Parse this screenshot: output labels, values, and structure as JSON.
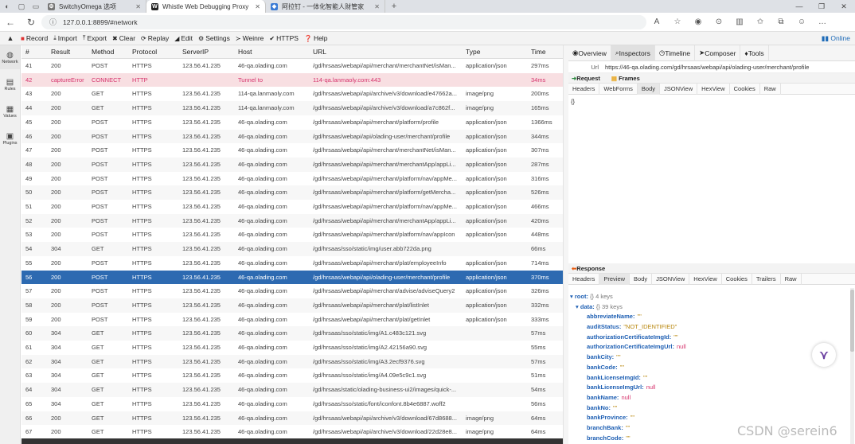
{
  "browser": {
    "tabs": [
      {
        "title": "SwitchyOmega 选项",
        "favicon": "gear-icon"
      },
      {
        "title": "Whistle Web Debugging Proxy",
        "favicon": "w-icon"
      },
      {
        "title": "阿拉钉 - 一体化智能人财管家",
        "favicon": "app-icon"
      }
    ],
    "url": "127.0.0.1:8899/#network"
  },
  "toolbar": {
    "record": "Record",
    "import": "Import",
    "export": "Export",
    "clear": "Clear",
    "replay": "Replay",
    "edit": "Edit",
    "settings": "Settings",
    "weinre": "Weinre",
    "https": "HTTPS",
    "help": "Help",
    "online": "Online"
  },
  "sidebar": [
    {
      "label": "Network"
    },
    {
      "label": "Rules"
    },
    {
      "label": "Values"
    },
    {
      "label": "Plugins"
    }
  ],
  "columns": [
    "#",
    "Result",
    "Method",
    "Protocol",
    "ServerIP",
    "Host",
    "URL",
    "Type",
    "Time"
  ],
  "rows": [
    [
      "41",
      "200",
      "POST",
      "HTTPS",
      "123.56.41.235",
      "46-qa.olading.com",
      "/gd/hrsaas/webapi/api/merchant/merchantNet/isMan...",
      "application/json",
      "297ms"
    ],
    [
      "42",
      "captureError",
      "CONNECT",
      "HTTP",
      "",
      "Tunnel to",
      "114-qa.lanmaoly.com:443",
      "",
      "34ms"
    ],
    [
      "43",
      "200",
      "GET",
      "HTTPS",
      "123.56.41.235",
      "114-qa.lanmaoly.com",
      "/gd/hrsaas/webapi/api/archive/v3/download/e47662a...",
      "image/png",
      "200ms"
    ],
    [
      "44",
      "200",
      "GET",
      "HTTPS",
      "123.56.41.235",
      "114-qa.lanmaoly.com",
      "/gd/hrsaas/webapi/api/archive/v3/download/a7c862f...",
      "image/png",
      "165ms"
    ],
    [
      "45",
      "200",
      "POST",
      "HTTPS",
      "123.56.41.235",
      "46-qa.olading.com",
      "/gd/hrsaas/webapi/api/merchant/platform/profile",
      "application/json",
      "1366ms"
    ],
    [
      "46",
      "200",
      "POST",
      "HTTPS",
      "123.56.41.235",
      "46-qa.olading.com",
      "/gd/hrsaas/webapi/api/olading-user/merchant/profile",
      "application/json",
      "344ms"
    ],
    [
      "47",
      "200",
      "POST",
      "HTTPS",
      "123.56.41.235",
      "46-qa.olading.com",
      "/gd/hrsaas/webapi/api/merchant/merchantNet/isMan...",
      "application/json",
      "307ms"
    ],
    [
      "48",
      "200",
      "POST",
      "HTTPS",
      "123.56.41.235",
      "46-qa.olading.com",
      "/gd/hrsaas/webapi/api/merchant/merchantApp/appLi...",
      "application/json",
      "287ms"
    ],
    [
      "49",
      "200",
      "POST",
      "HTTPS",
      "123.56.41.235",
      "46-qa.olading.com",
      "/gd/hrsaas/webapi/api/merchant/platform/nav/appMe...",
      "application/json",
      "316ms"
    ],
    [
      "50",
      "200",
      "POST",
      "HTTPS",
      "123.56.41.235",
      "46-qa.olading.com",
      "/gd/hrsaas/webapi/api/merchant/platform/getMercha...",
      "application/json",
      "526ms"
    ],
    [
      "51",
      "200",
      "POST",
      "HTTPS",
      "123.56.41.235",
      "46-qa.olading.com",
      "/gd/hrsaas/webapi/api/merchant/platform/nav/appMe...",
      "application/json",
      "466ms"
    ],
    [
      "52",
      "200",
      "POST",
      "HTTPS",
      "123.56.41.235",
      "46-qa.olading.com",
      "/gd/hrsaas/webapi/api/merchant/merchantApp/appLi...",
      "application/json",
      "420ms"
    ],
    [
      "53",
      "200",
      "POST",
      "HTTPS",
      "123.56.41.235",
      "46-qa.olading.com",
      "/gd/hrsaas/webapi/api/merchant/platform/nav/appIcon",
      "application/json",
      "448ms"
    ],
    [
      "54",
      "304",
      "GET",
      "HTTPS",
      "123.56.41.235",
      "46-qa.olading.com",
      "/gd/hrsaas/sso/static/img/user.abb722da.png",
      "",
      "66ms"
    ],
    [
      "55",
      "200",
      "POST",
      "HTTPS",
      "123.56.41.235",
      "46-qa.olading.com",
      "/gd/hrsaas/webapi/api/merchant/plat/employeeInfo",
      "application/json",
      "714ms"
    ],
    [
      "56",
      "200",
      "POST",
      "HTTPS",
      "123.56.41.235",
      "46-qa.olading.com",
      "/gd/hrsaas/webapi/api/olading-user/merchant/profile",
      "application/json",
      "370ms"
    ],
    [
      "57",
      "200",
      "POST",
      "HTTPS",
      "123.56.41.235",
      "46-qa.olading.com",
      "/gd/hrsaas/webapi/api/merchant/advise/adviseQuery2",
      "application/json",
      "326ms"
    ],
    [
      "58",
      "200",
      "POST",
      "HTTPS",
      "123.56.41.235",
      "46-qa.olading.com",
      "/gd/hrsaas/webapi/api/merchant/plat/listInlet",
      "application/json",
      "332ms"
    ],
    [
      "59",
      "200",
      "POST",
      "HTTPS",
      "123.56.41.235",
      "46-qa.olading.com",
      "/gd/hrsaas/webapi/api/merchant/plat/getInlet",
      "application/json",
      "333ms"
    ],
    [
      "60",
      "304",
      "GET",
      "HTTPS",
      "123.56.41.235",
      "46-qa.olading.com",
      "/gd/hrsaas/sso/static/img/A1.c483c121.svg",
      "",
      "57ms"
    ],
    [
      "61",
      "304",
      "GET",
      "HTTPS",
      "123.56.41.235",
      "46-qa.olading.com",
      "/gd/hrsaas/sso/static/img/A2.42156a90.svg",
      "",
      "55ms"
    ],
    [
      "62",
      "304",
      "GET",
      "HTTPS",
      "123.56.41.235",
      "46-qa.olading.com",
      "/gd/hrsaas/sso/static/img/A3.2ecf9376.svg",
      "",
      "57ms"
    ],
    [
      "63",
      "304",
      "GET",
      "HTTPS",
      "123.56.41.235",
      "46-qa.olading.com",
      "/gd/hrsaas/sso/static/img/A4.09e5c9c1.svg",
      "",
      "51ms"
    ],
    [
      "64",
      "304",
      "GET",
      "HTTPS",
      "123.56.41.235",
      "46-qa.olading.com",
      "/gd/hrsaas/static/olading-business-ui2/images/quick-...",
      "",
      "54ms"
    ],
    [
      "65",
      "304",
      "GET",
      "HTTPS",
      "123.56.41.235",
      "46-qa.olading.com",
      "/gd/hrsaas/sso/static/font/iconfont.8b4e6887.woff2",
      "",
      "56ms"
    ],
    [
      "66",
      "200",
      "GET",
      "HTTPS",
      "123.56.41.235",
      "46-qa.olading.com",
      "/gd/hrsaas/webapi/api/archive/v3/download/67d8688...",
      "image/png",
      "64ms"
    ],
    [
      "67",
      "200",
      "GET",
      "HTTPS",
      "123.56.41.235",
      "46-qa.olading.com",
      "/gd/hrsaas/webapi/api/archive/v3/download/22d28e8...",
      "image/png",
      "64ms"
    ]
  ],
  "selected_row": "56",
  "error_row": "42",
  "panel": {
    "tabs": [
      "Overview",
      "Inspectors",
      "Timeline",
      "Composer",
      "Tools"
    ],
    "url_label": "Url",
    "url_value": "https://46-qa.olading.com/gd/hrsaas/webapi/api/olading-user/merchant/profile",
    "request_label": "Request",
    "frames_label": "Frames",
    "request_tabs": [
      "Headers",
      "WebForms",
      "Body",
      "JSONView",
      "HexView",
      "Cookies",
      "Raw"
    ],
    "request_body": "{}",
    "response_label": "Response",
    "response_tabs": [
      "Headers",
      "Preview",
      "Body",
      "JSONView",
      "HexView",
      "Cookies",
      "Trailers",
      "Raw"
    ],
    "json_root": "root:",
    "json_root_meta": "{}  4 keys",
    "json_data": "data:",
    "json_data_meta": "{}  39 keys",
    "json_fields": [
      {
        "key": "abbreviateName:",
        "val": "\"\"",
        "kind": "str"
      },
      {
        "key": "auditStatus:",
        "val": "\"NOT_IDENTIFIED\"",
        "kind": "str"
      },
      {
        "key": "authorizationCertificateImgId:",
        "val": "\"\"",
        "kind": "str"
      },
      {
        "key": "authorizationCertificateImgUrl:",
        "val": "null",
        "kind": "null"
      },
      {
        "key": "bankCity:",
        "val": "\"\"",
        "kind": "str"
      },
      {
        "key": "bankCode:",
        "val": "\"\"",
        "kind": "str"
      },
      {
        "key": "bankLicenseImgId:",
        "val": "\"\"",
        "kind": "str"
      },
      {
        "key": "bankLicenseImgUrl:",
        "val": "null",
        "kind": "null"
      },
      {
        "key": "bankName:",
        "val": "null",
        "kind": "null"
      },
      {
        "key": "bankNo:",
        "val": "\"\"",
        "kind": "str"
      },
      {
        "key": "bankProvince:",
        "val": "\"\"",
        "kind": "str"
      },
      {
        "key": "branchBank:",
        "val": "\"\"",
        "kind": "str"
      },
      {
        "key": "branchCode:",
        "val": "\"\"",
        "kind": "str"
      }
    ]
  },
  "watermark": "CSDN @serein6"
}
